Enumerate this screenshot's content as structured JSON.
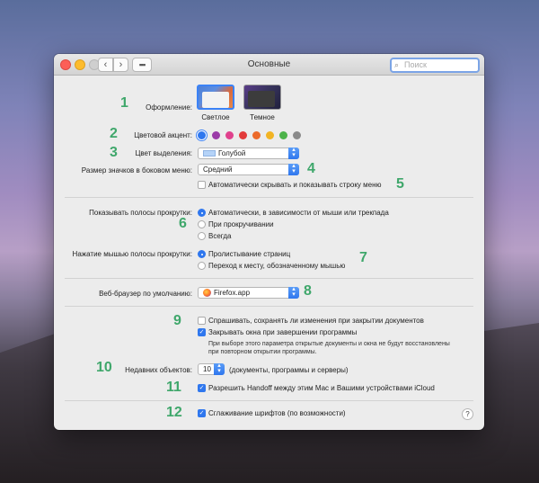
{
  "window": {
    "title": "Основные",
    "search_placeholder": "Поиск"
  },
  "appearance": {
    "label": "Оформление:",
    "options": [
      "Светлое",
      "Темное"
    ],
    "selected": "Светлое"
  },
  "accent": {
    "label": "Цветовой акцент:",
    "colors": [
      "#2f77ee",
      "#9b3ba8",
      "#e0418d",
      "#e23b3b",
      "#ec6a2a",
      "#f2b424",
      "#4cb34a",
      "#8a8a8a"
    ],
    "selected_index": 0
  },
  "highlight": {
    "label": "Цвет выделения:",
    "value": "Голубой"
  },
  "sidebar_icon_size": {
    "label": "Размер значков в боковом меню:",
    "value": "Средний"
  },
  "menu_bar": {
    "label": "Автоматически скрывать и показывать строку меню",
    "checked": false
  },
  "scroll_bars": {
    "label": "Показывать полосы прокрутки:",
    "options": [
      "Автоматически, в зависимости от мыши или трекпада",
      "При прокручивании",
      "Всегда"
    ],
    "selected_index": 0
  },
  "scroll_click": {
    "label": "Нажатие мышью полосы прокрутки:",
    "options": [
      "Пролистывание страниц",
      "Переход к месту, обозначенному мышью"
    ],
    "selected_index": 0
  },
  "browser": {
    "label": "Веб-браузер по умолчанию:",
    "value": "Firefox.app"
  },
  "documents": {
    "ask_keep": "Спрашивать, сохранять ли изменения при закрытии документов",
    "ask_keep_checked": false,
    "close_windows": "Закрывать окна при завершении программы",
    "close_windows_checked": true,
    "note": "При выборе этого параметра открытые документы и окна не будут восстановлены при повторном открытии программы."
  },
  "recent": {
    "label": "Недавних объектов:",
    "value": "10",
    "suffix": "(документы, программы и серверы)"
  },
  "handoff": {
    "label": "Разрешить Handoff между этим Mac и Вашими устройствами iCloud",
    "checked": true
  },
  "font_smoothing": {
    "label": "Сглаживание шрифтов (по возможности)",
    "checked": true
  },
  "help_label": "?",
  "annotations": [
    "1",
    "2",
    "3",
    "4",
    "5",
    "6",
    "7",
    "8",
    "9",
    "10",
    "11",
    "12"
  ]
}
